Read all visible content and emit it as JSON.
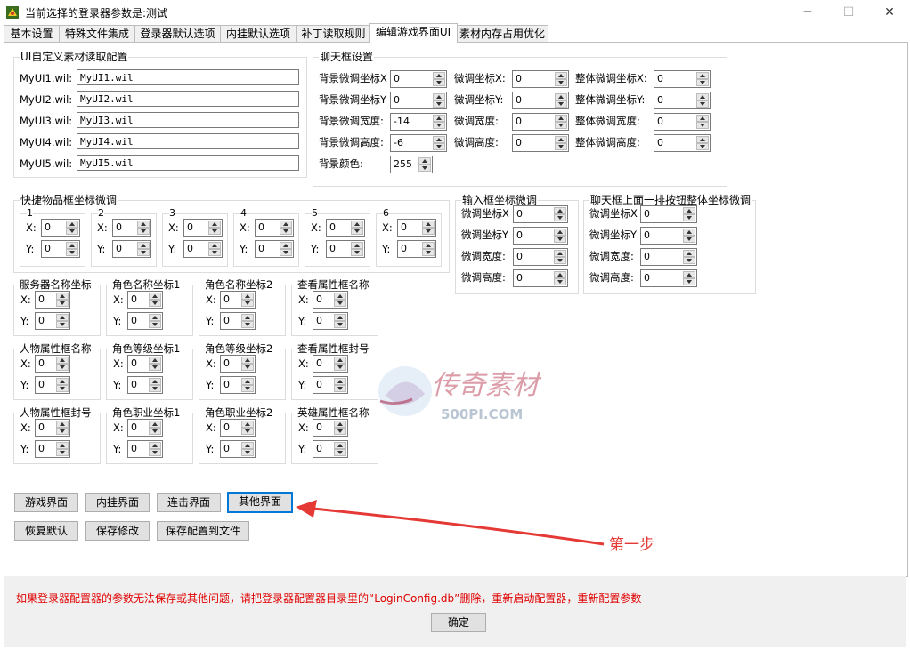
{
  "window": {
    "title": "当前选择的登录器参数是:测试",
    "controls": {
      "minimize": "─",
      "maximize": "☐",
      "close": "✕"
    }
  },
  "tabs": [
    "基本设置",
    "特殊文件集成",
    "登录器默认选项",
    "内挂默认选项",
    "补丁读取规则",
    "编辑游戏界面UI",
    "素材内存占用优化"
  ],
  "active_tab": "编辑游戏界面UI",
  "ui_config": {
    "title": "UI自定义素材读取配置",
    "rows": [
      {
        "label": "MyUI1.wil:",
        "value": "MyUI1.wil"
      },
      {
        "label": "MyUI2.wil:",
        "value": "MyUI2.wil"
      },
      {
        "label": "MyUI3.wil:",
        "value": "MyUI3.wil"
      },
      {
        "label": "MyUI4.wil:",
        "value": "MyUI4.wil"
      },
      {
        "label": "MyUI5.wil:",
        "value": "MyUI5.wil"
      }
    ]
  },
  "chat": {
    "title": "聊天框设置",
    "col1": [
      {
        "label": "背景微调坐标X",
        "value": "0"
      },
      {
        "label": "背景微调坐标Y",
        "value": "0"
      },
      {
        "label": "背景微调宽度:",
        "value": "-14"
      },
      {
        "label": "背景微调高度:",
        "value": "-6"
      }
    ],
    "col2": [
      {
        "label": "微调坐标X:",
        "value": "0"
      },
      {
        "label": "微调坐标Y:",
        "value": "0"
      },
      {
        "label": "微调宽度:",
        "value": "0"
      },
      {
        "label": "微调高度:",
        "value": "0"
      }
    ],
    "col3": [
      {
        "label": "整体微调坐标X:",
        "value": "0"
      },
      {
        "label": "整体微调坐标Y:",
        "value": "0"
      },
      {
        "label": "整体微调宽度:",
        "value": "0"
      },
      {
        "label": "整体微调高度:",
        "value": "0"
      }
    ],
    "bg_color_label": "背景颜色:",
    "bg_color_value": "255"
  },
  "quick": {
    "title": "快捷物品框坐标微调",
    "x_label": "X:",
    "y_label": "Y:",
    "slots": [
      {
        "n": "1",
        "x": "0",
        "y": "0"
      },
      {
        "n": "2",
        "x": "0",
        "y": "0"
      },
      {
        "n": "3",
        "x": "0",
        "y": "0"
      },
      {
        "n": "4",
        "x": "0",
        "y": "0"
      },
      {
        "n": "5",
        "x": "0",
        "y": "0"
      },
      {
        "n": "6",
        "x": "0",
        "y": "0"
      }
    ]
  },
  "input_box": {
    "title": "输入框坐标微调",
    "rows": [
      {
        "label": "微调坐标X",
        "value": "0"
      },
      {
        "label": "微调坐标Y",
        "value": "0"
      },
      {
        "label": "微调宽度:",
        "value": "0"
      },
      {
        "label": "微调高度:",
        "value": "0"
      }
    ]
  },
  "chat_top": {
    "title": "聊天框上面一排按钮整体坐标微调",
    "rows": [
      {
        "label": "微调坐标X",
        "value": "0"
      },
      {
        "label": "微调坐标Y",
        "value": "0"
      },
      {
        "label": "微调宽度:",
        "value": "0"
      },
      {
        "label": "微调高度:",
        "value": "0"
      }
    ]
  },
  "coords": [
    {
      "title": "服务器名称坐标",
      "x": "0",
      "y": "0"
    },
    {
      "title": "角色名称坐标1",
      "x": "0",
      "y": "0"
    },
    {
      "title": "角色名称坐标2",
      "x": "0",
      "y": "0"
    },
    {
      "title": "查看属性框名称",
      "x": "0",
      "y": "0"
    },
    {
      "title": "人物属性框名称",
      "x": "0",
      "y": "0"
    },
    {
      "title": "角色等级坐标1",
      "x": "0",
      "y": "0"
    },
    {
      "title": "角色等级坐标2",
      "x": "0",
      "y": "0"
    },
    {
      "title": "查看属性框封号",
      "x": "0",
      "y": "0"
    },
    {
      "title": "人物属性框封号",
      "x": "0",
      "y": "0"
    },
    {
      "title": "角色职业坐标1",
      "x": "0",
      "y": "0"
    },
    {
      "title": "角色职业坐标2",
      "x": "0",
      "y": "0"
    },
    {
      "title": "英雄属性框名称",
      "x": "0",
      "y": "0"
    }
  ],
  "buttons_row1": [
    "游戏界面",
    "内挂界面",
    "连击界面",
    "其他界面"
  ],
  "buttons_row2": [
    "恢复默认",
    "保存修改",
    "保存配置到文件"
  ],
  "annotation": "第一步",
  "watermark": {
    "text1": "传奇素材",
    "text2": "500PI.COM"
  },
  "warning": "如果登录器配置器的参数无法保存或其他问题，请把登录器配置器目录里的“LoginConfig.db”删除，重新启动配置器，重新配置参数",
  "ok_label": "确定",
  "colors": {
    "accent": "#0078d7",
    "warning": "#e00000",
    "annotation": "#e53935"
  }
}
